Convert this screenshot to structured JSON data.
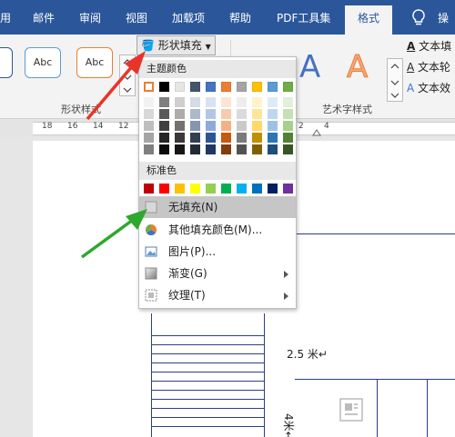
{
  "tabs": [
    "用",
    "邮件",
    "审阅",
    "视图",
    "加载项",
    "帮助",
    "PDF工具集",
    "格式",
    "操"
  ],
  "shape_styles": {
    "preview_label": "Abc",
    "group_label": "形状样式"
  },
  "shape_fill": {
    "label": "形状填充"
  },
  "wordart": {
    "group_label": "艺术字样式",
    "glyph": "A",
    "items": [
      "文本填",
      "文本轮",
      "文本效"
    ]
  },
  "ruler": {
    "numbers": [
      "18",
      "16",
      "14",
      "12",
      "2",
      "4"
    ]
  },
  "document": {
    "text_25": "2.5 米↵",
    "text_4": "4米↵"
  },
  "menu": {
    "theme_header": "主题颜色",
    "standard_header": "标准色",
    "theme_top": [
      "#ffffff",
      "#000000",
      "#e7e6e6",
      "#44546a",
      "#4472c4",
      "#ed7d31",
      "#a5a5a5",
      "#ffc000",
      "#5b9bd5",
      "#70ad47"
    ],
    "theme_shades": [
      [
        "#f2f2f2",
        "#7f7f7f",
        "#d0cece",
        "#d6dce4",
        "#d9e2f3",
        "#fbe5d5",
        "#ededed",
        "#fff2cc",
        "#deebf6",
        "#e2efd9"
      ],
      [
        "#d8d8d8",
        "#595959",
        "#aeabab",
        "#adb9ca",
        "#b4c6e7",
        "#f7cbac",
        "#dbdbdb",
        "#fee599",
        "#bdd7ee",
        "#c5e0b3"
      ],
      [
        "#bfbfbf",
        "#3f3f3f",
        "#757070",
        "#8496b0",
        "#8eaadb",
        "#f4b183",
        "#c9c9c9",
        "#ffd965",
        "#9cc3e5",
        "#a8d08d"
      ],
      [
        "#a5a5a5",
        "#262626",
        "#3a3838",
        "#323f4f",
        "#2f5496",
        "#c55a11",
        "#7b7b7b",
        "#bf9000",
        "#2e75b5",
        "#538135"
      ],
      [
        "#7f7f7f",
        "#0c0c0c",
        "#171616",
        "#222a35",
        "#1f3864",
        "#833c0b",
        "#525252",
        "#7f6000",
        "#1e4e79",
        "#375623"
      ]
    ],
    "standard_colors": [
      "#c00000",
      "#ff0000",
      "#ffc000",
      "#ffff00",
      "#92d050",
      "#00b050",
      "#00b0f0",
      "#0070c0",
      "#002060",
      "#7030a0"
    ],
    "items": [
      {
        "label": "无填充(N)",
        "icon": "no-fill-icon"
      },
      {
        "label": "其他填充颜色(M)...",
        "icon": "color-wheel-icon"
      },
      {
        "label": "图片(P)...",
        "icon": "picture-icon"
      },
      {
        "label": "渐变(G)",
        "icon": "gradient-icon"
      },
      {
        "label": "纹理(T)",
        "icon": "texture-icon"
      }
    ]
  },
  "colors": {
    "accent": "#2b579a",
    "arrow_red": "#e8342a",
    "arrow_green": "#2ea82e"
  }
}
